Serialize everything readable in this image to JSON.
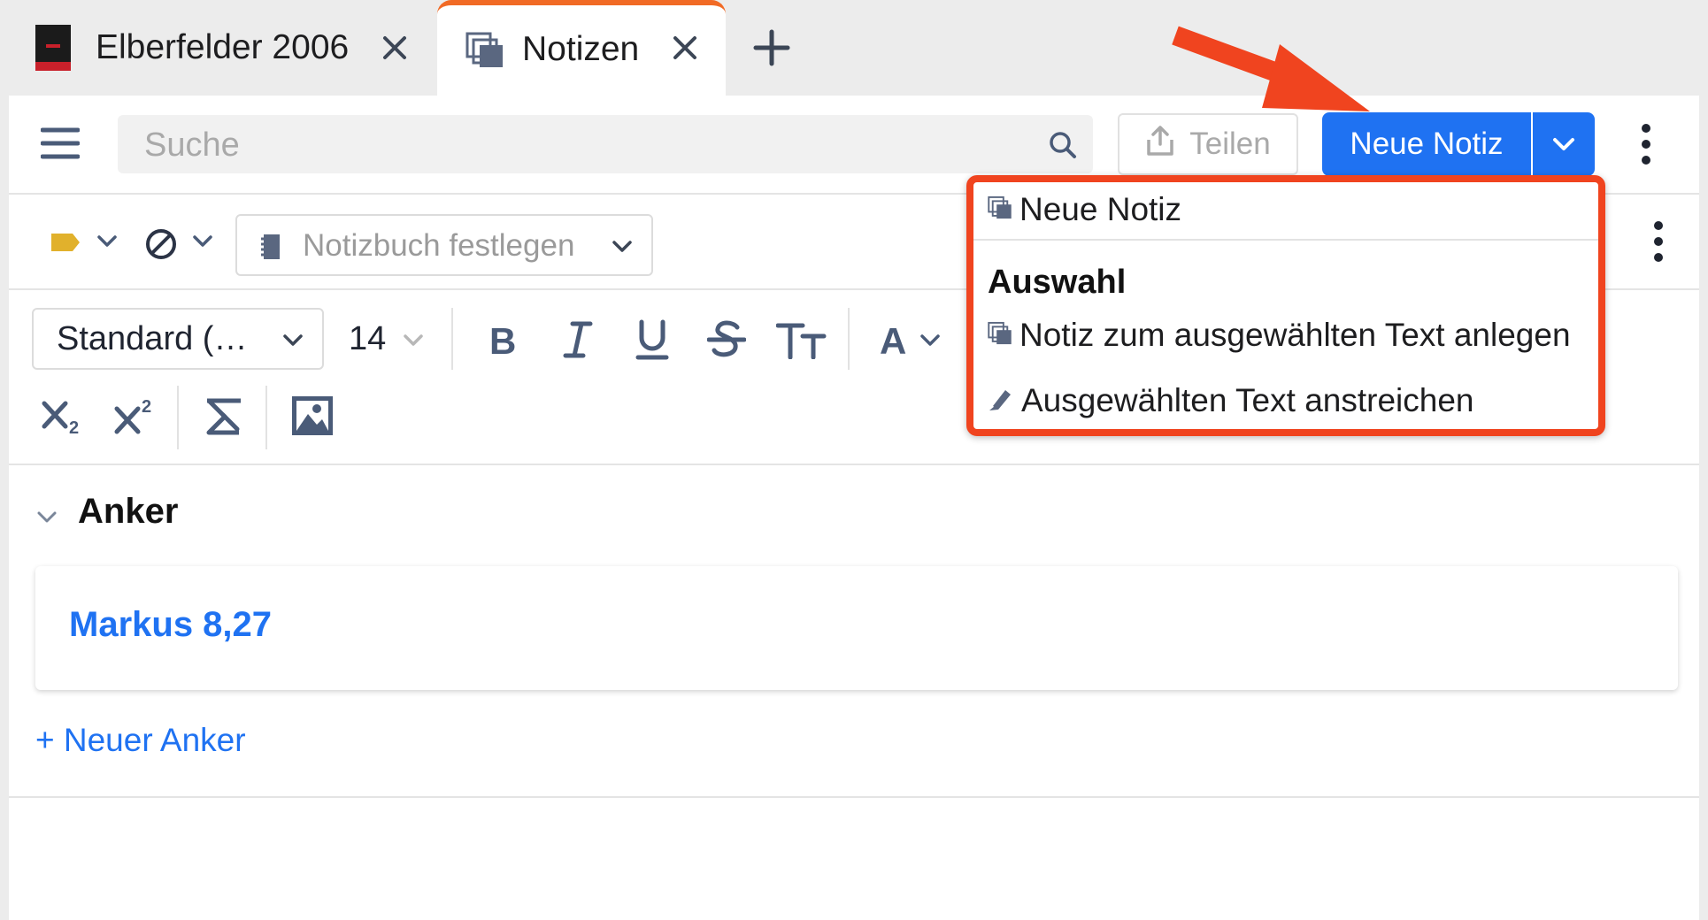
{
  "tabs": [
    {
      "label": "Elberfelder 2006",
      "icon": "book-cover-icon"
    },
    {
      "label": "Notizen",
      "icon": "notes-icon",
      "active": true
    }
  ],
  "toolbar": {
    "search_placeholder": "Suche",
    "share_label": "Teilen",
    "new_note_label": "Neue Notiz"
  },
  "meta": {
    "notebook_placeholder": "Notizbuch festlegen"
  },
  "format": {
    "style_value": "Standard (…",
    "font_size": "14"
  },
  "dropdown": {
    "item_new": "Neue Notiz",
    "section_header": "Auswahl",
    "item_note_selection": "Notiz zum ausgewählten Text anlegen",
    "item_highlight": "Ausgewählten Text anstreichen"
  },
  "anchors": {
    "title": "Anker",
    "items": [
      "Markus 8,27"
    ],
    "add_label": "+ Neuer Anker"
  },
  "colors": {
    "accent": "#1f72f2",
    "annotation": "#f0441f",
    "tab_active": "#f16a25",
    "tag": "#e1b12c"
  }
}
